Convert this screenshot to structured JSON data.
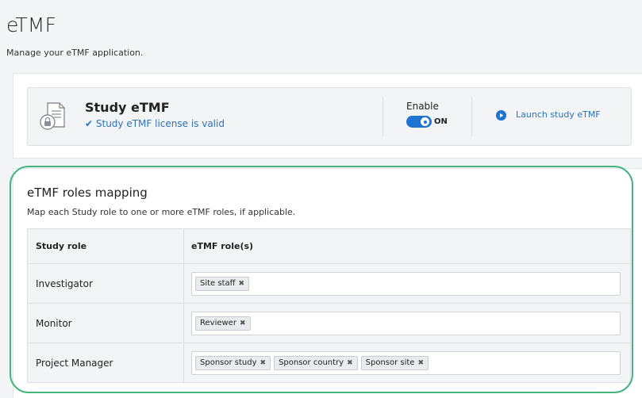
{
  "page": {
    "title": "eTMF",
    "subtitle": "Manage your eTMF application."
  },
  "study_card": {
    "title": "Study eTMF",
    "license_status": "✔ Study eTMF license is valid",
    "icon": "document-lock-icon",
    "enable_label": "Enable",
    "toggle_state": "ON",
    "launch_label": "Launch study eTMF",
    "launch_icon": "play-circle-icon"
  },
  "roles": {
    "title": "eTMF roles mapping",
    "description": "Map each Study role to one or more eTMF roles, if applicable.",
    "columns": [
      "Study role",
      "eTMF role(s)"
    ],
    "rows": [
      {
        "study_role": "Investigator",
        "etmf_roles": [
          "Site staff"
        ]
      },
      {
        "study_role": "Monitor",
        "etmf_roles": [
          "Reviewer"
        ]
      },
      {
        "study_role": "Project Manager",
        "etmf_roles": [
          "Sponsor study",
          "Sponsor country",
          "Sponsor site"
        ]
      }
    ]
  },
  "colors": {
    "accent": "#1d74d2",
    "link": "#2c72b7",
    "highlight": "#45b57e"
  }
}
